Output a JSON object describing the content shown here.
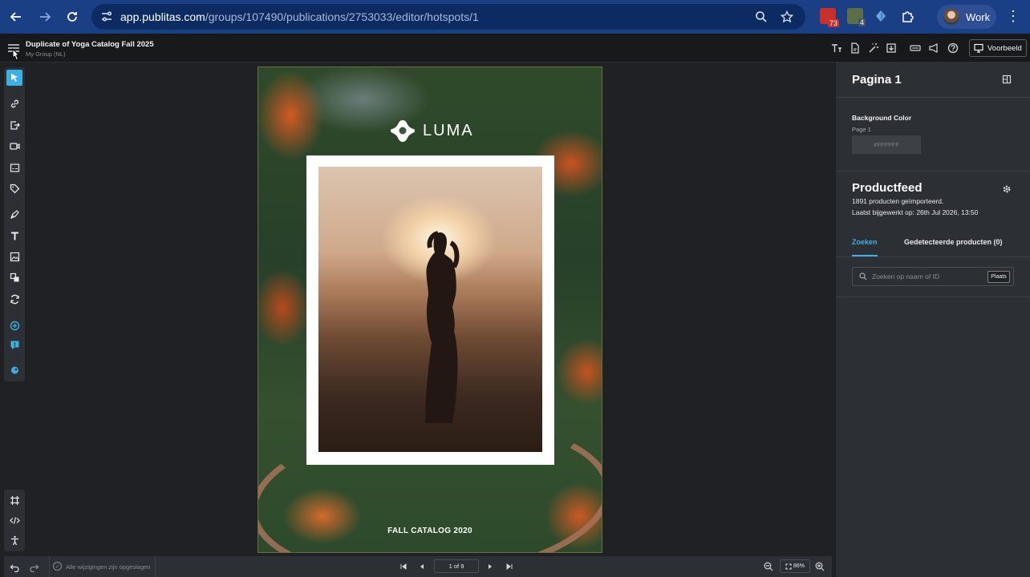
{
  "browser": {
    "url_host": "app.publitas.com",
    "url_path": "/groups/107490/publications/2753033/editor/hotspots/1",
    "profile_label": "Work",
    "ext_badge_1": "73",
    "ext_badge_2": "4"
  },
  "header": {
    "title": "Duplicate of Yoga Catalog Fall 2025",
    "subtitle": "My Group (NL)",
    "preview_label": "Voorbeeld"
  },
  "page_content": {
    "brand": "LUMA",
    "caption": "FALL CATALOG 2020"
  },
  "panel": {
    "title": "Pagina 1",
    "bg_label": "Background Color",
    "bg_sub": "Page 1",
    "bg_value": "#FFFFFF",
    "productfeed_title": "Productfeed",
    "productfeed_count": "1891 producten geïmporteerd.",
    "productfeed_updated": "Laatst bijgewerkt op: 26th Jul 2026, 13:50",
    "tab_search": "Zoeken",
    "tab_detected": "Gedetecteerde producten (0)",
    "search_placeholder": "Zoeken op naam of ID",
    "place_button": "Plaats"
  },
  "bottom": {
    "saved_status": "Alle wijzigingen zijn opgeslagen",
    "page_indicator": "1 of 9",
    "zoom": "86%"
  },
  "colors": {
    "browser_bar": "#1b3f84",
    "accent": "#3ab0e5",
    "panel_bg": "#2c2f33",
    "canvas_bg": "#1f2124"
  }
}
